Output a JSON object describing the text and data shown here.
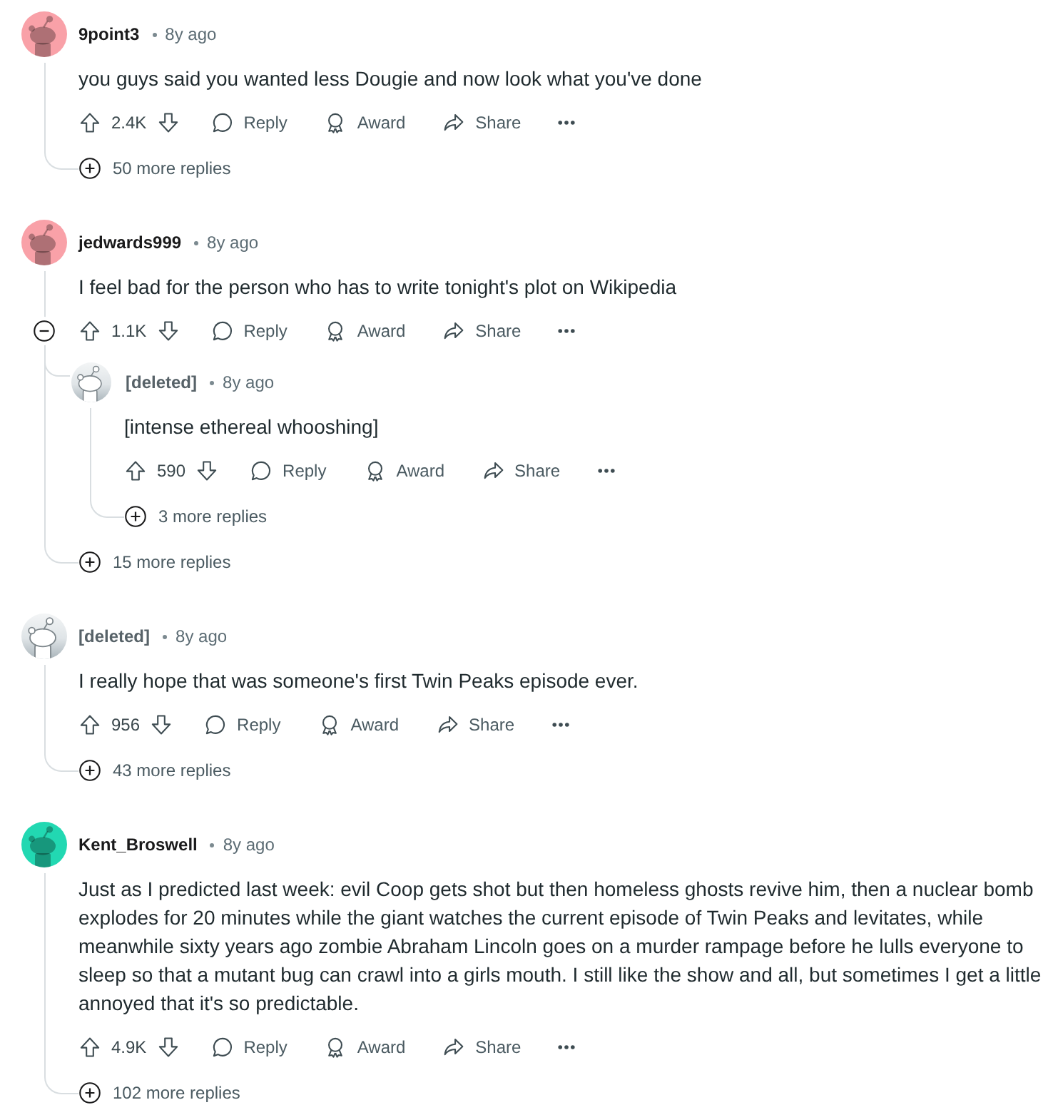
{
  "comments": [
    {
      "author": "9point3",
      "deleted": false,
      "color": "#f9a1a8",
      "time": "8y ago",
      "body": "you guys said you wanted less Dougie and now look what you've done",
      "score": "2.4K",
      "actions": [
        {
          "kind": "reply",
          "label": "Reply"
        },
        {
          "kind": "award",
          "label": "Award"
        },
        {
          "kind": "share",
          "label": "Share"
        }
      ],
      "expanded": false,
      "more_replies": "50 more replies"
    },
    {
      "author": "jedwards999",
      "deleted": false,
      "color": "#f9a1a8",
      "time": "8y ago",
      "body": "I feel bad for the person who has to write tonight's plot on Wikipedia",
      "score": "1.1K",
      "actions": [
        {
          "kind": "reply",
          "label": "Reply"
        },
        {
          "kind": "award",
          "label": "Award"
        },
        {
          "kind": "share",
          "label": "Share"
        }
      ],
      "expanded": true,
      "children": [
        {
          "author": "[deleted]",
          "deleted": true,
          "time": "8y ago",
          "body": "[intense ethereal whooshing]",
          "score": "590",
          "actions": [
            {
              "kind": "reply",
              "label": "Reply"
            },
            {
              "kind": "award",
              "label": "Award"
            },
            {
              "kind": "share",
              "label": "Share"
            }
          ],
          "expanded": false,
          "more_replies": "3 more replies"
        }
      ],
      "more_replies": "15 more replies"
    },
    {
      "author": "[deleted]",
      "deleted": true,
      "time": "8y ago",
      "body": "I really hope that was someone's first Twin Peaks episode ever.",
      "score": "956",
      "actions": [
        {
          "kind": "reply",
          "label": "Reply"
        },
        {
          "kind": "award",
          "label": "Award"
        },
        {
          "kind": "share",
          "label": "Share"
        }
      ],
      "expanded": false,
      "more_replies": "43 more replies"
    },
    {
      "author": "Kent_Broswell",
      "deleted": false,
      "color": "#22d8b2",
      "time": "8y ago",
      "body": "Just as I predicted last week: evil Coop gets shot but then homeless ghosts revive him, then a nuclear bomb explodes for 20 minutes while the giant watches the current episode of Twin Peaks and levitates, while meanwhile sixty years ago zombie Abraham Lincoln goes on a murder rampage before he lulls everyone to sleep so that a mutant bug can crawl into a girls mouth. I still like the show and all, but sometimes I get a little annoyed that it's so predictable.",
      "score": "4.9K",
      "actions": [
        {
          "kind": "reply",
          "label": "Reply"
        },
        {
          "kind": "award",
          "label": "Award"
        },
        {
          "kind": "share",
          "label": "Share"
        }
      ],
      "expanded": false,
      "more_replies": "102 more replies"
    }
  ]
}
